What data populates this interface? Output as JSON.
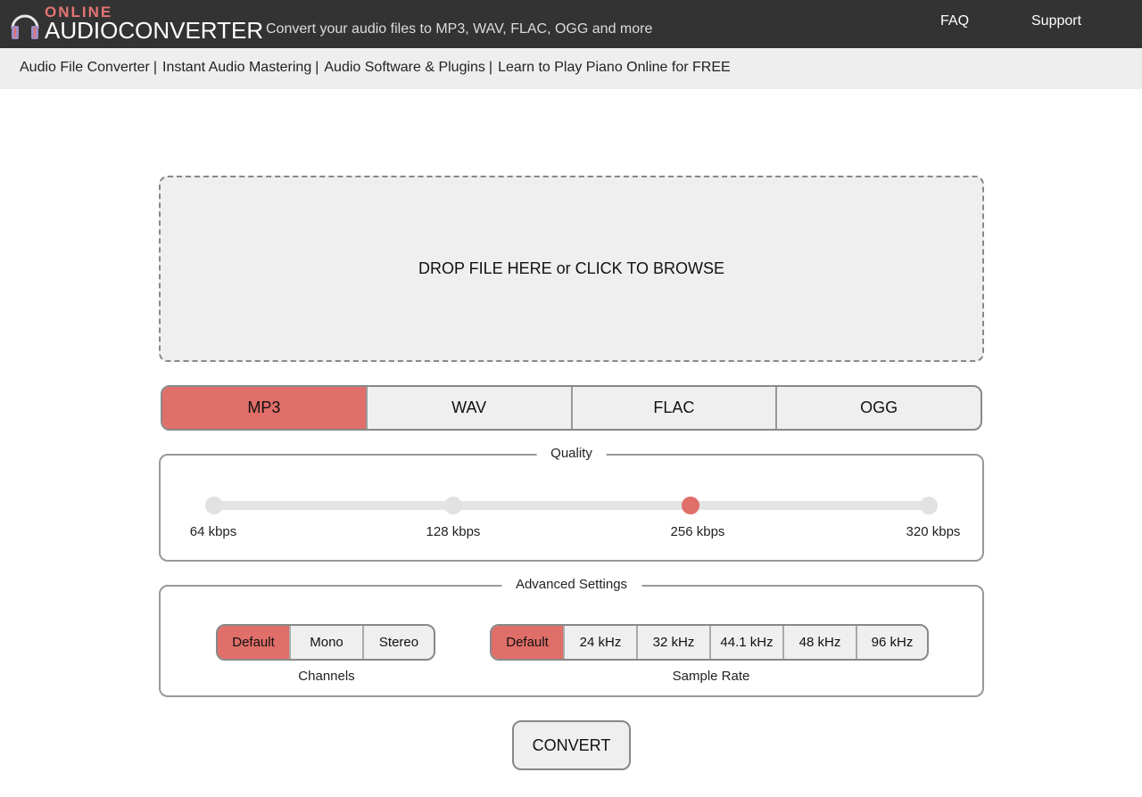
{
  "header": {
    "logo_top": "ONLINE",
    "logo_main": "AUDIOCONVERTER",
    "tagline": "Convert your audio files to MP3, WAV, FLAC, OGG and more",
    "links": [
      {
        "label": "FAQ"
      },
      {
        "label": "Support"
      }
    ]
  },
  "subnav": {
    "items": [
      {
        "label": "Audio File Converter",
        "sep": "|"
      },
      {
        "label": "Instant Audio Mastering",
        "sep": "|"
      },
      {
        "label": "Audio Software & Plugins",
        "sep": "|"
      },
      {
        "label": "Learn to Play Piano Online for FREE",
        "sep": ""
      }
    ]
  },
  "dropzone": {
    "text": "DROP FILE HERE or CLICK TO BROWSE"
  },
  "formats": {
    "selected": "MP3",
    "options": [
      "MP3",
      "WAV",
      "FLAC",
      "OGG"
    ]
  },
  "quality": {
    "legend": "Quality",
    "options": [
      "64 kbps",
      "128 kbps",
      "256 kbps",
      "320 kbps"
    ],
    "selected_index": 2
  },
  "advanced": {
    "legend": "Advanced Settings",
    "channels": {
      "label": "Channels",
      "options": [
        "Default",
        "Mono",
        "Stereo"
      ],
      "selected_index": 0
    },
    "sample_rate": {
      "label": "Sample Rate",
      "options": [
        "Default",
        "24 kHz",
        "32 kHz",
        "44.1 kHz",
        "48 kHz",
        "96 kHz"
      ],
      "selected_index": 0
    }
  },
  "convert": {
    "label": "CONVERT"
  },
  "colors": {
    "accent": "#e06e69",
    "header_bg": "#333333",
    "subnav_bg": "#eeeeee",
    "logo_accent": "#e57373"
  }
}
